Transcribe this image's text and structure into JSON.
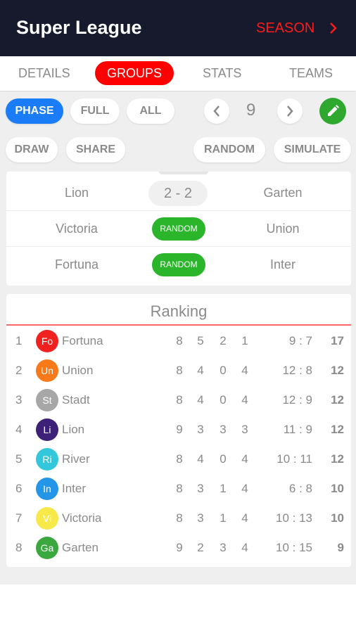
{
  "header": {
    "title": "Super League",
    "season_label": "SEASON"
  },
  "tabs": [
    {
      "label": "DETAILS",
      "active": false
    },
    {
      "label": "GROUPS",
      "active": true
    },
    {
      "label": "STATS",
      "active": false
    },
    {
      "label": "TEAMS",
      "active": false
    }
  ],
  "view_filter": {
    "phase": "PHASE",
    "full": "FULL",
    "all": "ALL",
    "active": "PHASE"
  },
  "round_number": "9",
  "actions": {
    "draw": "DRAW",
    "share": "SHARE",
    "random": "RANDOM",
    "simulate": "SIMULATE"
  },
  "matches": [
    {
      "home": "Lion",
      "score": "2 - 2",
      "away": "Garten"
    },
    {
      "home": "Victoria",
      "button": "RANDOM",
      "away": "Union"
    },
    {
      "home": "Fortuna",
      "button": "RANDOM",
      "away": "Inter"
    }
  ],
  "ranking": {
    "title": "Ranking",
    "rows": [
      {
        "pos": "1",
        "abbr": "Fo",
        "team": "Fortuna",
        "color": "#f0211f",
        "p": "8",
        "w": "5",
        "d": "2",
        "l": "1",
        "goals": "9 : 7",
        "pts": "17"
      },
      {
        "pos": "2",
        "abbr": "Un",
        "team": "Union",
        "color": "#f7791a",
        "p": "8",
        "w": "4",
        "d": "0",
        "l": "4",
        "goals": "12 : 8",
        "pts": "12"
      },
      {
        "pos": "3",
        "abbr": "St",
        "team": "Stadt",
        "color": "#a7a7a7",
        "p": "8",
        "w": "4",
        "d": "0",
        "l": "4",
        "goals": "12 : 9",
        "pts": "12"
      },
      {
        "pos": "4",
        "abbr": "Li",
        "team": "Lion",
        "color": "#3d2178",
        "p": "9",
        "w": "3",
        "d": "3",
        "l": "3",
        "goals": "11 : 9",
        "pts": "12"
      },
      {
        "pos": "5",
        "abbr": "Ri",
        "team": "River",
        "color": "#33c7dc",
        "p": "8",
        "w": "4",
        "d": "0",
        "l": "4",
        "goals": "10 : 11",
        "pts": "12"
      },
      {
        "pos": "6",
        "abbr": "In",
        "team": "Inter",
        "color": "#2595e8",
        "p": "8",
        "w": "3",
        "d": "1",
        "l": "4",
        "goals": "6 : 8",
        "pts": "10"
      },
      {
        "pos": "7",
        "abbr": "Vi",
        "team": "Victoria",
        "color": "#f7e94a",
        "p": "8",
        "w": "3",
        "d": "1",
        "l": "4",
        "goals": "10 : 13",
        "pts": "10"
      },
      {
        "pos": "8",
        "abbr": "Ga",
        "team": "Garten",
        "color": "#3aa83e",
        "p": "9",
        "w": "2",
        "d": "3",
        "l": "4",
        "goals": "10 : 15",
        "pts": "9"
      }
    ]
  },
  "colors": {
    "header_bg": "#161a2c",
    "accent_red": "#ff0000",
    "accent_blue": "#1a7cf6",
    "accent_green": "#2bb52b"
  },
  "icons": {
    "season_chevron": "chevron-right-icon",
    "prev": "chevron-left-icon",
    "next": "chevron-right-icon",
    "edit": "pencil-icon"
  }
}
